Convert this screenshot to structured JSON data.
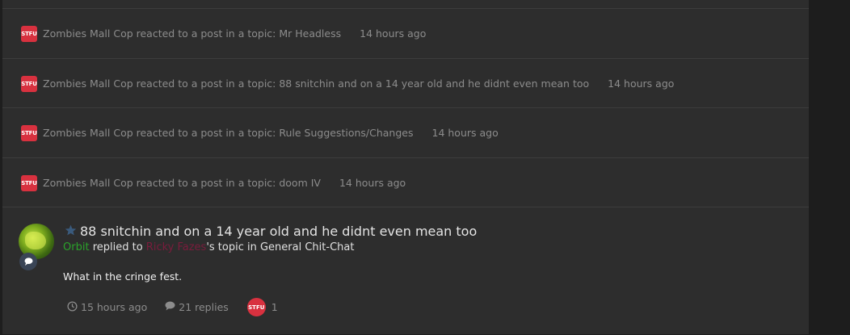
{
  "activity": [
    {
      "badge": "STFU",
      "text": "Zombies Mall Cop reacted to a post in a topic: Mr Headless",
      "time": "14 hours ago"
    },
    {
      "badge": "STFU",
      "text": "Zombies Mall Cop reacted to a post in a topic: 88 snitchin and on a 14 year old and he didnt even mean too",
      "time": "14 hours ago"
    },
    {
      "badge": "STFU",
      "text": "Zombies Mall Cop reacted to a post in a topic: Rule Suggestions/Changes",
      "time": "14 hours ago"
    },
    {
      "badge": "STFU",
      "text": "Zombies Mall Cop reacted to a post in a topic: doom IV",
      "time": "14 hours ago"
    }
  ],
  "post": {
    "title": "88 snitchin and on a 14 year old and he didnt even mean too",
    "author": "Orbit",
    "replied_to": "replied to",
    "topic_owner": "Ricky Fazes",
    "topic_suffix": "'s topic in General Chit-Chat",
    "body": "What in the cringe fest.",
    "time": "15 hours ago",
    "replies": "21 replies",
    "reaction_badge": "STFU",
    "reaction_count": "1"
  },
  "colors": {
    "background": "#2d2d2d",
    "badge": "#d8313f",
    "author": "#2aa22a",
    "topic_owner": "#7a1c3c"
  },
  "icons": {
    "unread_star": "star-icon",
    "reply": "speech-bubble-icon",
    "clock": "clock-icon",
    "comments": "comment-icon"
  }
}
